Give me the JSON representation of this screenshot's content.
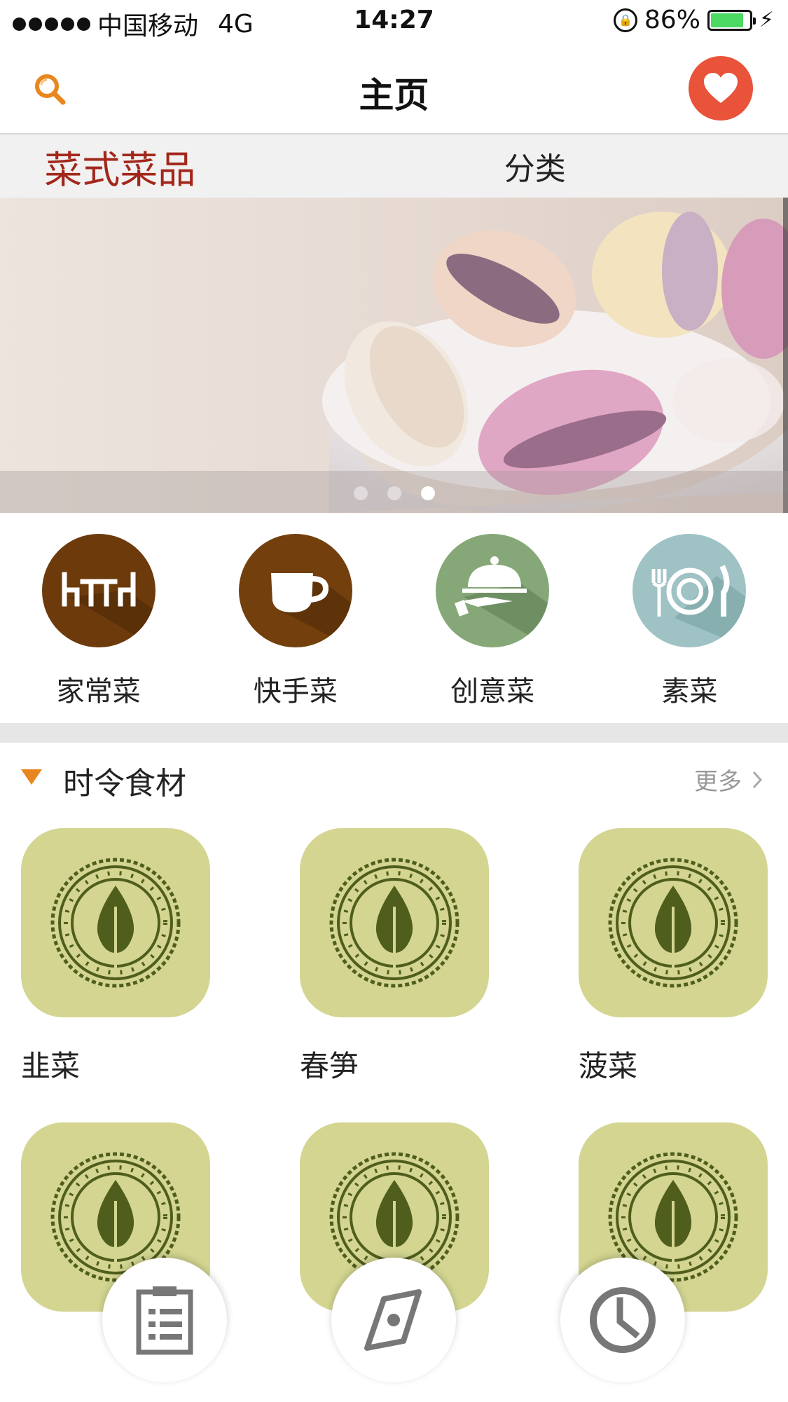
{
  "status_bar": {
    "carrier": "中国移动",
    "network": "4G",
    "time": "14:27",
    "battery": "86%",
    "battery_level": 0.86
  },
  "nav": {
    "title": "主页",
    "left_icon": "search-icon",
    "right_icon": "heart-icon",
    "accent_color": "#e8533a"
  },
  "top_tabs": [
    {
      "label": "菜式菜品",
      "active": true
    },
    {
      "label": "分类",
      "active": false
    }
  ],
  "banner": {
    "dots_total": 3,
    "active_dot": 3
  },
  "categories": [
    {
      "label": "家常菜",
      "icon": "dining-table-icon",
      "color": "#6d3a0c"
    },
    {
      "label": "快手菜",
      "icon": "cup-icon",
      "color": "#723f0d"
    },
    {
      "label": "创意菜",
      "icon": "serving-cloche-icon",
      "color": "#86a878"
    },
    {
      "label": "素菜",
      "icon": "plate-cutlery-icon",
      "color": "#9fc2c4"
    }
  ],
  "seasonal": {
    "title": "时令食材",
    "more": "更多",
    "items": [
      {
        "name": "韭菜"
      },
      {
        "name": "春笋"
      },
      {
        "name": "菠菜"
      },
      {
        "name": ""
      },
      {
        "name": ""
      },
      {
        "name": ""
      }
    ]
  },
  "dock": [
    {
      "icon": "clipboard-list-icon"
    },
    {
      "icon": "compass-icon"
    },
    {
      "icon": "clock-icon"
    }
  ]
}
